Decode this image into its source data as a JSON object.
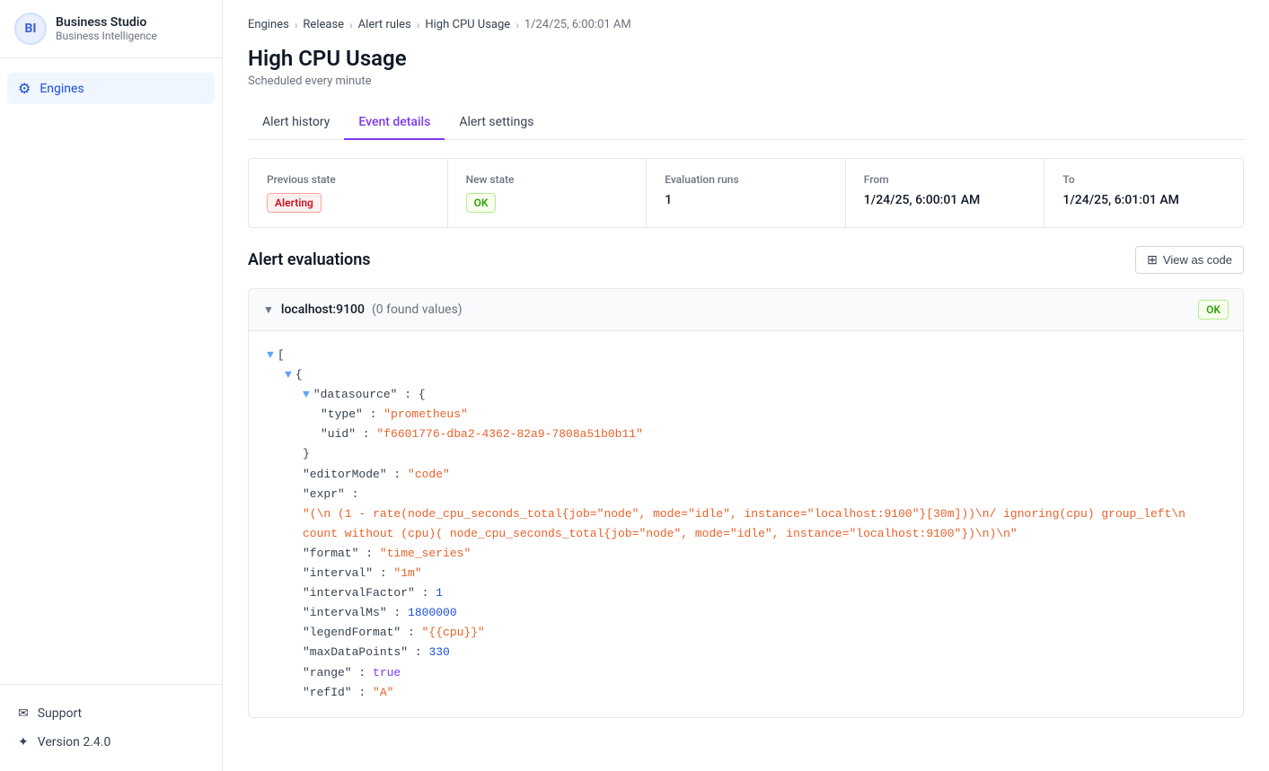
{
  "app": {
    "name": "Business Studio",
    "subtitle": "Business Intelligence",
    "logo_initials": "BI"
  },
  "sidebar": {
    "nav_items": [
      {
        "id": "engines",
        "label": "Engines",
        "icon": "⚙",
        "active": true
      }
    ],
    "bottom_items": [
      {
        "id": "support",
        "label": "Support",
        "icon": "✉"
      },
      {
        "id": "version",
        "label": "Version 2.4.0",
        "icon": "✦"
      }
    ]
  },
  "breadcrumb": {
    "items": [
      "Engines",
      "Release",
      "Alert rules",
      "High CPU Usage",
      "1/24/25, 6:00:01 AM"
    ]
  },
  "page": {
    "title": "High CPU Usage",
    "subtitle": "Scheduled every minute"
  },
  "tabs": [
    {
      "id": "history",
      "label": "Alert history",
      "active": false
    },
    {
      "id": "event",
      "label": "Event details",
      "active": true
    },
    {
      "id": "settings",
      "label": "Alert settings",
      "active": false
    }
  ],
  "info_cards": [
    {
      "label": "Previous state",
      "value": "Alerting",
      "type": "badge-alerting"
    },
    {
      "label": "New state",
      "value": "OK",
      "type": "badge-ok"
    },
    {
      "label": "Evaluation runs",
      "value": "1",
      "type": "text"
    },
    {
      "label": "From",
      "value": "1/24/25, 6:00:01 AM",
      "type": "text"
    },
    {
      "label": "To",
      "value": "1/24/25, 6:01:01 AM",
      "type": "text"
    }
  ],
  "evaluations": {
    "section_title": "Alert evaluations",
    "view_code_label": "View as code",
    "panel": {
      "host": "localhost:9100",
      "found_values": "(0 found values)",
      "status": "OK",
      "code": {
        "datasource_type": "prometheus",
        "datasource_uid": "f6601776-dba2-4362-82a9-7808a51b0b11",
        "editorMode": "code",
        "expr": "(\\n (1 - rate(node_cpu_seconds_total{job=\"node\", mode=\"idle\", instance=\"localhost:9100\"}[30m]))\\n/ ignoring(cpu) group_left\\n count without (cpu)( node_cpu_seconds_total{job=\"node\", mode=\"idle\", instance=\"localhost:9100\"})\\n)\\n",
        "format": "time_series",
        "interval": "1m",
        "intervalFactor": "1",
        "intervalMs": "1800000",
        "legendFormat": "{{cpu}}",
        "maxDataPoints": "330",
        "range": "true",
        "refId": "A"
      }
    }
  }
}
